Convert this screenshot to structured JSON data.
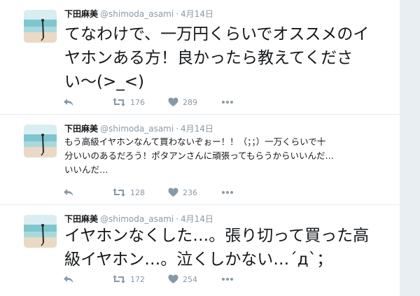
{
  "tweets": [
    {
      "name": "下田麻美",
      "handle": "@shimoda_asami",
      "separator": "·",
      "date": "4月14日",
      "text_lines": [
        "てなわけで、一万円くらいでオススメのイ",
        "ヤホンある方！良かったら教えてくださ",
        "い〜(>_<)"
      ],
      "retweets": "176",
      "likes": "289"
    },
    {
      "name": "下田麻美",
      "handle": "@shimoda_asami",
      "separator": "·",
      "date": "4月14日",
      "text_lines": [
        "もう高級イヤホンなんて買わないぞぉー！！（；；）一万くらいで十",
        "分いいのあるだろう！ポタアンさんに頑張ってもらうからいいんだ…",
        "いいんだ…"
      ],
      "retweets": "128",
      "likes": "236"
    },
    {
      "name": "下田麻美",
      "handle": "@shimoda_asami",
      "separator": "·",
      "date": "4月14日",
      "text_lines": [
        "イヤホンなくした…。張り切って買った高",
        "級イヤホン…。泣くしかない…´д`；"
      ],
      "retweets": "172",
      "likes": "254"
    }
  ],
  "icons": {
    "avatar": "profile-photo-beach",
    "reply": "reply-icon",
    "retweet": "retweet-icon",
    "like": "heart-icon",
    "more": "more-icon"
  },
  "colors": {
    "meta_gray": "#8899a6",
    "text": "#14171a",
    "divider": "#e6ecf0",
    "side_rail": "#e9eef2"
  }
}
